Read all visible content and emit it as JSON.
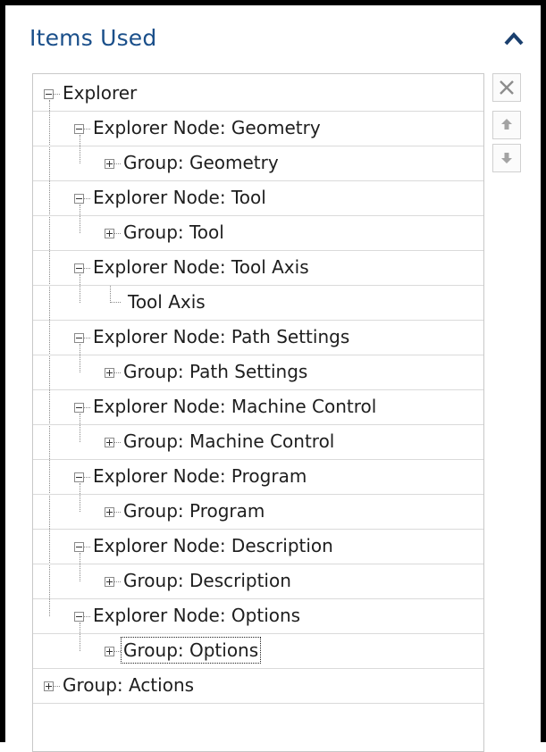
{
  "panel": {
    "title": "Items Used",
    "collapse_icon": "chevron-up-icon"
  },
  "tree": {
    "rows": [
      {
        "label": "Explorer",
        "level": 0,
        "toggle": "minus"
      },
      {
        "label": "Explorer Node: Geometry",
        "level": 1,
        "toggle": "minus"
      },
      {
        "label": "Group: Geometry",
        "level": 2,
        "toggle": "plus"
      },
      {
        "label": "Explorer Node: Tool",
        "level": 1,
        "toggle": "minus"
      },
      {
        "label": "Group: Tool",
        "level": 2,
        "toggle": "plus"
      },
      {
        "label": "Explorer Node: Tool Axis",
        "level": 1,
        "toggle": "minus"
      },
      {
        "label": "Tool Axis",
        "level": 2,
        "toggle": "none"
      },
      {
        "label": "Explorer Node: Path Settings",
        "level": 1,
        "toggle": "minus"
      },
      {
        "label": "Group: Path Settings",
        "level": 2,
        "toggle": "plus"
      },
      {
        "label": "Explorer Node: Machine Control",
        "level": 1,
        "toggle": "minus"
      },
      {
        "label": "Group: Machine Control",
        "level": 2,
        "toggle": "plus"
      },
      {
        "label": "Explorer Node: Program",
        "level": 1,
        "toggle": "minus"
      },
      {
        "label": "Group: Program",
        "level": 2,
        "toggle": "plus"
      },
      {
        "label": "Explorer Node: Description",
        "level": 1,
        "toggle": "minus"
      },
      {
        "label": "Group: Description",
        "level": 2,
        "toggle": "plus"
      },
      {
        "label": "Explorer Node: Options",
        "level": 1,
        "toggle": "minus"
      },
      {
        "label": "Group: Options",
        "level": 2,
        "toggle": "plus",
        "selected": true
      },
      {
        "label": "Group: Actions",
        "level": 0,
        "toggle": "plus"
      }
    ]
  },
  "side_buttons": {
    "remove_icon": "close-icon",
    "move_up_icon": "arrow-up-icon",
    "move_down_icon": "arrow-down-icon"
  }
}
